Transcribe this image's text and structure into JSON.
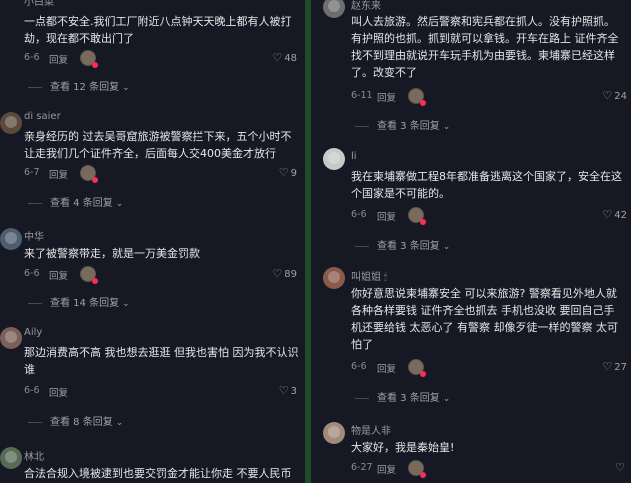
{
  "left_column": [
    {
      "username": "小白菜",
      "text": "一点都不安全.我们工厂附近八点钟天天晚上都有人被打劫，现在都不敢出门了",
      "date": "6-6",
      "reply_label": "回复",
      "likes": "48",
      "view_replies": "查看 12 条回复"
    },
    {
      "username": "di saier",
      "text": "亲身经历的 过去吴哥窟旅游被警察拦下来，五个小时不让走我们几个证件齐全，后面每人交400美金才放行",
      "date": "6-7",
      "reply_label": "回复",
      "likes": "9",
      "view_replies": "查看 4 条回复"
    },
    {
      "username": "中华",
      "text": "来了被警察带走，就是一万美金罚款",
      "date": "6-6",
      "reply_label": "回复",
      "likes": "89",
      "view_replies": "查看 14 条回复"
    },
    {
      "username": "Aily",
      "text": "那边消费高不高 我也想去逛逛 但我也害怕 因为我不认识谁",
      "date": "6-6",
      "reply_label": "回复",
      "likes": "3",
      "view_replies": "查看 8 条回复"
    },
    {
      "username": "林北",
      "text": "合法合规入境被逮到也要交罚金才能让你走 不要人民币",
      "date": "",
      "reply_label": "",
      "likes": "",
      "view_replies": ""
    }
  ],
  "right_column": [
    {
      "username": "赵东来",
      "text": "叫人去旅游。然后警察和宪兵都在抓人。没有护照抓。有护照的也抓。抓到就可以拿钱。开车在路上 证件齐全 找不到理由就说开车玩手机为由要钱。柬埔寨已经这样了。改变不了",
      "date": "6-11",
      "reply_label": "回复",
      "likes": "24",
      "view_replies": "查看 3 条回复"
    },
    {
      "username": "li",
      "text": "我在柬埔寨做工程8年都准备逃离这个国家了，安全在这个国家是不可能的。",
      "date": "6-6",
      "reply_label": "回复",
      "likes": "42",
      "view_replies": "查看 3 条回复"
    },
    {
      "username": "叫姐姐 🕯",
      "text": "你好意思说柬埔寨安全 可以来旅游? 警察看见外地人就各种各样要钱 证件齐全也抓去 手机也没收 要回自己手机还要给钱 太恶心了 有警察 却像歹徒一样的警察 太可怕了",
      "date": "6-6",
      "reply_label": "回复",
      "likes": "27",
      "view_replies": "查看 3 条回复"
    },
    {
      "username": "物是人非",
      "text": "大家好，我是秦始皇!",
      "date": "6-27",
      "reply_label": "回复",
      "likes": "",
      "view_replies": ""
    }
  ],
  "colors": {
    "background": "#161823",
    "divider": "#1f4a2b",
    "text": "#e6e6e8",
    "muted": "#8a8b90",
    "accent": "#fe2c55"
  },
  "icons": [
    "heart-icon",
    "chevron-down-icon",
    "author-avatar-icon"
  ]
}
